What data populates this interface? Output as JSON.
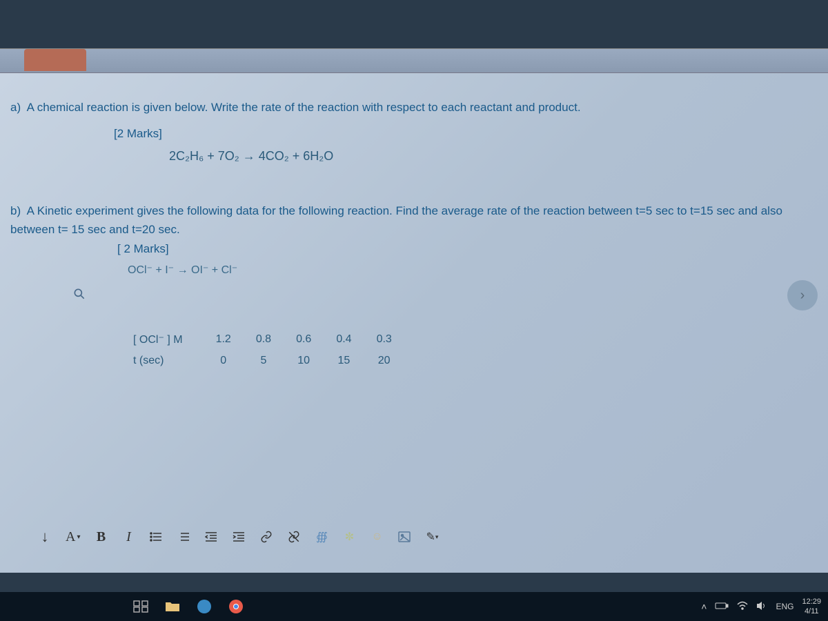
{
  "question_a": {
    "prefix": "a)",
    "text": "A chemical reaction is given below. Write the rate of the reaction with respect to each reactant and product.",
    "marks": "[2 Marks]",
    "equation": "2C₂H₆ + 7O₂  →  4CO₂ + 6H₂O"
  },
  "question_b": {
    "prefix": "b)",
    "text": "A Kinetic experiment gives the following data for the following reaction. Find the average rate of the reaction between t=5 sec to t=15 sec and also between t= 15 sec and t=20 sec.",
    "marks": "[ 2 Marks]",
    "equation": "OCl⁻ + I⁻  →  OI⁻ + Cl⁻"
  },
  "table": {
    "row1_label": "[ OCl⁻ ] M",
    "row1_vals": [
      "1.2",
      "0.8",
      "0.6",
      "0.4",
      "0.3"
    ],
    "row2_label": "t (sec)",
    "row2_vals": [
      "0",
      "5",
      "10",
      "15",
      "20"
    ]
  },
  "toolbar": {
    "paragraph": "↓",
    "font": "A",
    "font_caret": "▾",
    "bold": "B",
    "italic": "I"
  },
  "nav": {
    "next": "›"
  },
  "systray": {
    "lang": "ENG",
    "time": "12:29",
    "date": "4/11"
  }
}
